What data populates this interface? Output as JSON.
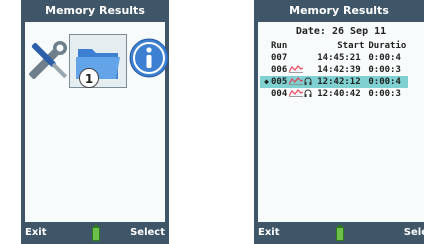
{
  "left_screen": {
    "title": "Memory Results",
    "callout_number": "1",
    "icons": [
      "tools-icon",
      "folder-icon",
      "info-icon"
    ],
    "softkey_left": "Exit",
    "softkey_right": "Select"
  },
  "right_screen": {
    "title": "Memory Results",
    "date_line": "Date: 26 Sep 11",
    "columns": [
      "Run",
      "Start",
      "Duratio"
    ],
    "rows": [
      {
        "run": "007",
        "start": "14:45:21",
        "duration": "0:00:4",
        "graph": false,
        "headphone": false,
        "selected": false
      },
      {
        "run": "006",
        "start": "14:42:39",
        "duration": "0:00:3",
        "graph": true,
        "headphone": false,
        "selected": false
      },
      {
        "run": "005",
        "start": "12:42:12",
        "duration": "0:00:4",
        "graph": true,
        "headphone": true,
        "selected": true
      },
      {
        "run": "004",
        "start": "12:40:42",
        "duration": "0:00:3",
        "graph": true,
        "headphone": true,
        "selected": false
      }
    ],
    "softkey_left": "Exit",
    "softkey_right": "Sele"
  },
  "colors": {
    "frame": "#3f5668",
    "selection": "#7fd0d0",
    "battery": "#6cc04a",
    "graph": "#e0445a"
  }
}
